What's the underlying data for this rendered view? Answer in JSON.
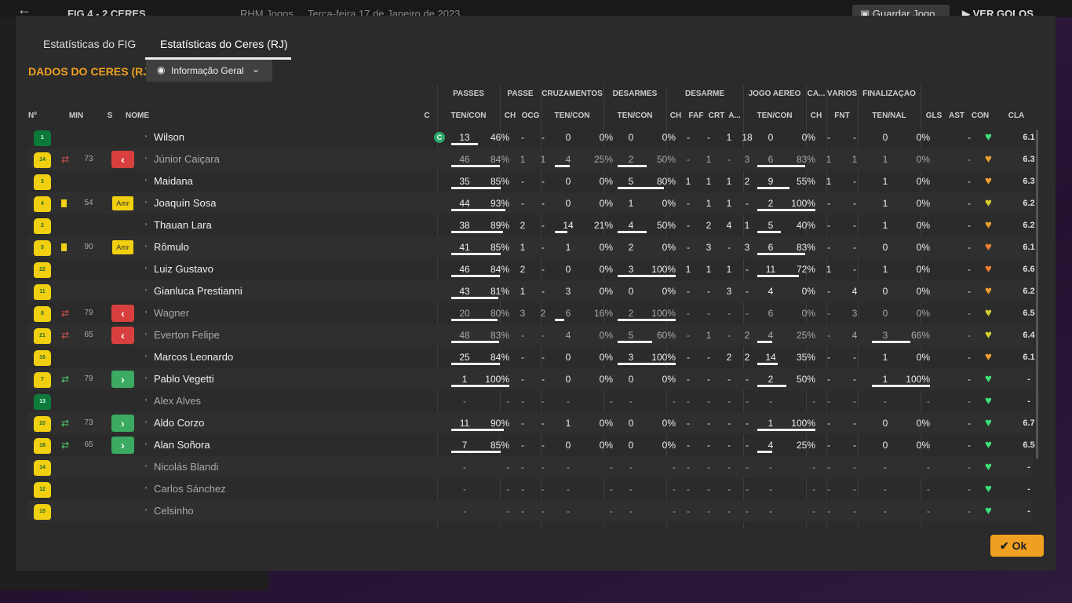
{
  "topbar": {
    "score": "FIG  4 - 2  CERES",
    "subtitle": "RHM Jogos",
    "date": "Terça-feira 17 de Janeiro de 2023",
    "save_label": "Guardar Jogo",
    "goals_label": "VER GOLOS"
  },
  "tabs": [
    {
      "label": "Estatísticas do FIG",
      "active": false
    },
    {
      "label": "Estatísticas do Ceres (RJ)",
      "active": true
    }
  ],
  "section_title": "DADOS DO CERES (RJ)",
  "view_dropdown": {
    "label": "Informação Geral"
  },
  "group_headers": {
    "passes": "PASSES",
    "passe": "PASSE",
    "cruzamentos": "CRUZAMENTOS",
    "desarmes": "DESARMES",
    "desarme": "DESARME",
    "jogo_aereo": "JOGO AÉREO",
    "ca": "CA...",
    "varios": "VÁRIOS",
    "finalizacao": "FINALIZAÇÃO"
  },
  "columns": {
    "no": "Nº",
    "min": "MIN",
    "s": "S",
    "nome": "NOME",
    "c": "C",
    "p_tencon": "TEN/CON",
    "p_ch": "CH",
    "p_ocg": "OCG",
    "cr_tencon": "TEN/CON",
    "de_tencon": "TEN/CON",
    "d_ch": "CH",
    "d_faf": "FAF",
    "d_crt": "CRT",
    "d_a": "A...",
    "ja_tencon": "TEN/CON",
    "ca_ch": "CH",
    "v_fnt": "FNT",
    "f_tennal": "TEN/NAL",
    "gls": "GLS",
    "ast": "AST",
    "con": "CON",
    "cla": "CLA"
  },
  "players": [
    {
      "num": "1",
      "kit": "g",
      "card": false,
      "min": "",
      "sub": "",
      "pos": "",
      "name": "Wilson",
      "dim": false,
      "captain": true,
      "p": [
        "13",
        "46%"
      ],
      "pb": 46,
      "pch": "-",
      "pocg": "-",
      "cr": [
        "0",
        "0%"
      ],
      "crb": 0,
      "de": [
        "0",
        "0%"
      ],
      "deb": 0,
      "dch": "-",
      "dfaf": "-",
      "dcrt": "1",
      "da": "18",
      "ja": [
        "0",
        "0%"
      ],
      "jab": 0,
      "cach": "-",
      "fnt": "-",
      "fin": [
        "0",
        "0%"
      ],
      "finb": 0,
      "gls": "",
      "ast": "-",
      "mor": "#3ee07a",
      "cla": "6.1"
    },
    {
      "num": "14",
      "kit": "y",
      "card": false,
      "min": "73",
      "sub": "out",
      "pos": "",
      "name": "Júnior Caiçara",
      "dim": true,
      "captain": false,
      "p": [
        "46",
        "84%"
      ],
      "pb": 84,
      "pch": "1",
      "pocg": "1",
      "cr": [
        "4",
        "25%"
      ],
      "crb": 25,
      "de": [
        "2",
        "50%"
      ],
      "deb": 50,
      "dch": "-",
      "dfaf": "1",
      "dcrt": "-",
      "da": "3",
      "ja": [
        "6",
        "83%"
      ],
      "jab": 83,
      "cach": "1",
      "fnt": "1",
      "fin": [
        "1",
        "0%"
      ],
      "finb": 0,
      "gls": "",
      "ast": "-",
      "mor": "#f0a030",
      "cla": "6.3"
    },
    {
      "num": "3",
      "kit": "y",
      "card": false,
      "min": "",
      "sub": "",
      "pos": "",
      "name": "Maidana",
      "dim": false,
      "captain": false,
      "p": [
        "35",
        "85%"
      ],
      "pb": 85,
      "pch": "-",
      "pocg": "-",
      "cr": [
        "0",
        "0%"
      ],
      "crb": 0,
      "de": [
        "5",
        "80%"
      ],
      "deb": 80,
      "dch": "1",
      "dfaf": "1",
      "dcrt": "1",
      "da": "2",
      "ja": [
        "9",
        "55%"
      ],
      "jab": 55,
      "cach": "1",
      "fnt": "-",
      "fin": [
        "1",
        "0%"
      ],
      "finb": 0,
      "gls": "",
      "ast": "-",
      "mor": "#f0a030",
      "cla": "6.3"
    },
    {
      "num": "4",
      "kit": "y",
      "card": true,
      "min": "54",
      "sub": "",
      "pos": "Amr",
      "name": "Joaquín Sosa",
      "dim": false,
      "captain": false,
      "p": [
        "44",
        "93%"
      ],
      "pb": 93,
      "pch": "-",
      "pocg": "-",
      "cr": [
        "0",
        "0%"
      ],
      "crb": 0,
      "de": [
        "1",
        "0%"
      ],
      "deb": 0,
      "dch": "-",
      "dfaf": "1",
      "dcrt": "1",
      "da": "-",
      "ja": [
        "2",
        "100%"
      ],
      "jab": 100,
      "cach": "-",
      "fnt": "-",
      "fin": [
        "1",
        "0%"
      ],
      "finb": 0,
      "gls": "",
      "ast": "-",
      "mor": "#d8d030",
      "cla": "6.2"
    },
    {
      "num": "2",
      "kit": "y",
      "card": false,
      "min": "",
      "sub": "",
      "pos": "",
      "name": "Thauan Lara",
      "dim": false,
      "captain": false,
      "p": [
        "38",
        "89%"
      ],
      "pb": 89,
      "pch": "2",
      "pocg": "-",
      "cr": [
        "14",
        "21%"
      ],
      "crb": 21,
      "de": [
        "4",
        "50%"
      ],
      "deb": 50,
      "dch": "-",
      "dfaf": "2",
      "dcrt": "4",
      "da": "1",
      "ja": [
        "5",
        "40%"
      ],
      "jab": 40,
      "cach": "-",
      "fnt": "-",
      "fin": [
        "1",
        "0%"
      ],
      "finb": 0,
      "gls": "",
      "ast": "-",
      "mor": "#f0a030",
      "cla": "6.2"
    },
    {
      "num": "5",
      "kit": "y",
      "card": true,
      "min": "90",
      "sub": "",
      "pos": "Amr",
      "name": "Rômulo",
      "dim": false,
      "captain": false,
      "p": [
        "41",
        "85%"
      ],
      "pb": 85,
      "pch": "1",
      "pocg": "-",
      "cr": [
        "1",
        "0%"
      ],
      "crb": 0,
      "de": [
        "2",
        "0%"
      ],
      "deb": 0,
      "dch": "-",
      "dfaf": "3",
      "dcrt": "-",
      "da": "3",
      "ja": [
        "6",
        "83%"
      ],
      "jab": 83,
      "cach": "-",
      "fnt": "-",
      "fin": [
        "0",
        "0%"
      ],
      "finb": 0,
      "gls": "",
      "ast": "-",
      "mor": "#f08030",
      "cla": "6.1"
    },
    {
      "num": "22",
      "kit": "y",
      "card": false,
      "min": "",
      "sub": "",
      "pos": "",
      "name": "Luiz Gustavo",
      "dim": false,
      "captain": false,
      "p": [
        "46",
        "84%"
      ],
      "pb": 84,
      "pch": "2",
      "pocg": "-",
      "cr": [
        "0",
        "0%"
      ],
      "crb": 0,
      "de": [
        "3",
        "100%"
      ],
      "deb": 100,
      "dch": "1",
      "dfaf": "1",
      "dcrt": "1",
      "da": "-",
      "ja": [
        "11",
        "72%"
      ],
      "jab": 72,
      "cach": "1",
      "fnt": "-",
      "fin": [
        "1",
        "0%"
      ],
      "finb": 0,
      "gls": "",
      "ast": "-",
      "mor": "#f08030",
      "cla": "6.6"
    },
    {
      "num": "11",
      "kit": "y",
      "card": false,
      "min": "",
      "sub": "",
      "pos": "",
      "name": "Gianluca Prestianni",
      "dim": false,
      "captain": false,
      "p": [
        "43",
        "81%"
      ],
      "pb": 81,
      "pch": "1",
      "pocg": "-",
      "cr": [
        "3",
        "0%"
      ],
      "crb": 0,
      "de": [
        "0",
        "0%"
      ],
      "deb": 0,
      "dch": "-",
      "dfaf": "-",
      "dcrt": "3",
      "da": "-",
      "ja": [
        "4",
        "0%"
      ],
      "jab": 0,
      "cach": "-",
      "fnt": "4",
      "fin": [
        "0",
        "0%"
      ],
      "finb": 0,
      "gls": "",
      "ast": "-",
      "mor": "#f0a030",
      "cla": "6.2"
    },
    {
      "num": "8",
      "kit": "y",
      "card": false,
      "min": "79",
      "sub": "out",
      "pos": "",
      "name": "Wagner",
      "dim": true,
      "captain": false,
      "p": [
        "20",
        "80%"
      ],
      "pb": 80,
      "pch": "3",
      "pocg": "2",
      "cr": [
        "6",
        "16%"
      ],
      "crb": 16,
      "de": [
        "2",
        "100%"
      ],
      "deb": 100,
      "dch": "-",
      "dfaf": "-",
      "dcrt": "-",
      "da": "-",
      "ja": [
        "6",
        "0%"
      ],
      "jab": 0,
      "cach": "-",
      "fnt": "3",
      "fin": [
        "0",
        "0%"
      ],
      "finb": 0,
      "gls": "",
      "ast": "-",
      "mor": "#d8d030",
      "cla": "6.5"
    },
    {
      "num": "21",
      "kit": "y",
      "card": false,
      "min": "65",
      "sub": "out",
      "pos": "",
      "name": "Everton Felipe",
      "dim": true,
      "captain": false,
      "p": [
        "48",
        "83%"
      ],
      "pb": 83,
      "pch": "-",
      "pocg": "-",
      "cr": [
        "4",
        "0%"
      ],
      "crb": 0,
      "de": [
        "5",
        "60%"
      ],
      "deb": 60,
      "dch": "-",
      "dfaf": "1",
      "dcrt": "-",
      "da": "2",
      "ja": [
        "4",
        "25%"
      ],
      "jab": 25,
      "cach": "-",
      "fnt": "4",
      "fin": [
        "3",
        "66%"
      ],
      "finb": 66,
      "gls": "",
      "ast": "-",
      "mor": "#d8d030",
      "cla": "6.4"
    },
    {
      "num": "16",
      "kit": "y",
      "card": false,
      "min": "",
      "sub": "",
      "pos": "",
      "name": "Marcos Leonardo",
      "dim": false,
      "captain": false,
      "p": [
        "25",
        "84%"
      ],
      "pb": 84,
      "pch": "-",
      "pocg": "-",
      "cr": [
        "0",
        "0%"
      ],
      "crb": 0,
      "de": [
        "3",
        "100%"
      ],
      "deb": 100,
      "dch": "-",
      "dfaf": "-",
      "dcrt": "2",
      "da": "2",
      "ja": [
        "14",
        "35%"
      ],
      "jab": 35,
      "cach": "-",
      "fnt": "-",
      "fin": [
        "1",
        "0%"
      ],
      "finb": 0,
      "gls": "",
      "ast": "-",
      "mor": "#f0a030",
      "cla": "6.1"
    },
    {
      "num": "7",
      "kit": "y",
      "card": false,
      "min": "79",
      "sub": "in",
      "pos": "",
      "name": "Pablo Vegetti",
      "dim": false,
      "captain": false,
      "p": [
        "1",
        "100%"
      ],
      "pb": 100,
      "pch": "-",
      "pocg": "-",
      "cr": [
        "0",
        "0%"
      ],
      "crb": 0,
      "de": [
        "0",
        "0%"
      ],
      "deb": 0,
      "dch": "-",
      "dfaf": "-",
      "dcrt": "-",
      "da": "-",
      "ja": [
        "2",
        "50%"
      ],
      "jab": 50,
      "cach": "-",
      "fnt": "-",
      "fin": [
        "1",
        "100%"
      ],
      "finb": 100,
      "gls": "",
      "ast": "-",
      "mor": "#3ee07a",
      "cla": "-"
    },
    {
      "num": "13",
      "kit": "g",
      "card": false,
      "min": "",
      "sub": "",
      "pos": "",
      "name": "Alex Alves",
      "dim": true,
      "captain": false,
      "p": [
        "-",
        "-"
      ],
      "pb": -1,
      "pch": "-",
      "pocg": "-",
      "cr": [
        "-",
        "-"
      ],
      "crb": -1,
      "de": [
        "-",
        "-"
      ],
      "deb": -1,
      "dch": "-",
      "dfaf": "-",
      "dcrt": "-",
      "da": "-",
      "ja": [
        "-",
        "-"
      ],
      "jab": -1,
      "cach": "-",
      "fnt": "-",
      "fin": [
        "-",
        "-"
      ],
      "finb": -1,
      "gls": "",
      "ast": "-",
      "mor": "#3ee07a",
      "cla": "-"
    },
    {
      "num": "20",
      "kit": "y",
      "card": false,
      "min": "73",
      "sub": "in",
      "pos": "",
      "name": "Aldo Corzo",
      "dim": false,
      "captain": false,
      "p": [
        "11",
        "90%"
      ],
      "pb": 90,
      "pch": "-",
      "pocg": "-",
      "cr": [
        "1",
        "0%"
      ],
      "crb": 0,
      "de": [
        "0",
        "0%"
      ],
      "deb": 0,
      "dch": "-",
      "dfaf": "-",
      "dcrt": "-",
      "da": "-",
      "ja": [
        "1",
        "100%"
      ],
      "jab": 100,
      "cach": "-",
      "fnt": "-",
      "fin": [
        "0",
        "0%"
      ],
      "finb": 0,
      "gls": "",
      "ast": "-",
      "mor": "#3ee07a",
      "cla": "6.7"
    },
    {
      "num": "18",
      "kit": "y",
      "card": false,
      "min": "65",
      "sub": "in",
      "pos": "",
      "name": "Alan Soñora",
      "dim": false,
      "captain": false,
      "p": [
        "7",
        "85%"
      ],
      "pb": 85,
      "pch": "-",
      "pocg": "-",
      "cr": [
        "0",
        "0%"
      ],
      "crb": 0,
      "de": [
        "0",
        "0%"
      ],
      "deb": 0,
      "dch": "-",
      "dfaf": "-",
      "dcrt": "-",
      "da": "-",
      "ja": [
        "4",
        "25%"
      ],
      "jab": 25,
      "cach": "-",
      "fnt": "-",
      "fin": [
        "0",
        "0%"
      ],
      "finb": 0,
      "gls": "",
      "ast": "-",
      "mor": "#3ee07a",
      "cla": "6.5"
    },
    {
      "num": "14",
      "kit": "y",
      "card": false,
      "min": "",
      "sub": "",
      "pos": "",
      "name": "Nicolás Blandi",
      "dim": true,
      "captain": false,
      "p": [
        "-",
        "-"
      ],
      "pb": -1,
      "pch": "-",
      "pocg": "-",
      "cr": [
        "-",
        "-"
      ],
      "crb": -1,
      "de": [
        "-",
        "-"
      ],
      "deb": -1,
      "dch": "-",
      "dfaf": "-",
      "dcrt": "-",
      "da": "-",
      "ja": [
        "-",
        "-"
      ],
      "jab": -1,
      "cach": "-",
      "fnt": "-",
      "fin": [
        "-",
        "-"
      ],
      "finb": -1,
      "gls": "",
      "ast": "-",
      "mor": "#3ee07a",
      "cla": "-"
    },
    {
      "num": "12",
      "kit": "y",
      "card": false,
      "min": "",
      "sub": "",
      "pos": "",
      "name": "Carlos Sánchez",
      "dim": true,
      "captain": false,
      "p": [
        "-",
        "-"
      ],
      "pb": -1,
      "pch": "-",
      "pocg": "-",
      "cr": [
        "-",
        "-"
      ],
      "crb": -1,
      "de": [
        "-",
        "-"
      ],
      "deb": -1,
      "dch": "-",
      "dfaf": "-",
      "dcrt": "-",
      "da": "-",
      "ja": [
        "-",
        "-"
      ],
      "jab": -1,
      "cach": "-",
      "fnt": "-",
      "fin": [
        "-",
        "-"
      ],
      "finb": -1,
      "gls": "",
      "ast": "-",
      "mor": "#3ee07a",
      "cla": "-"
    },
    {
      "num": "15",
      "kit": "y",
      "card": false,
      "min": "",
      "sub": "",
      "pos": "",
      "name": "Celsinho",
      "dim": true,
      "captain": false,
      "p": [
        "-",
        "-"
      ],
      "pb": -1,
      "pch": "-",
      "pocg": "-",
      "cr": [
        "-",
        "-"
      ],
      "crb": -1,
      "de": [
        "-",
        "-"
      ],
      "deb": -1,
      "dch": "-",
      "dfaf": "-",
      "dcrt": "-",
      "da": "-",
      "ja": [
        "-",
        "-"
      ],
      "jab": -1,
      "cach": "-",
      "fnt": "-",
      "fin": [
        "-",
        "-"
      ],
      "finb": -1,
      "gls": "",
      "ast": "-",
      "mor": "#3ee07a",
      "cla": "-"
    }
  ],
  "ok_label": "Ok"
}
